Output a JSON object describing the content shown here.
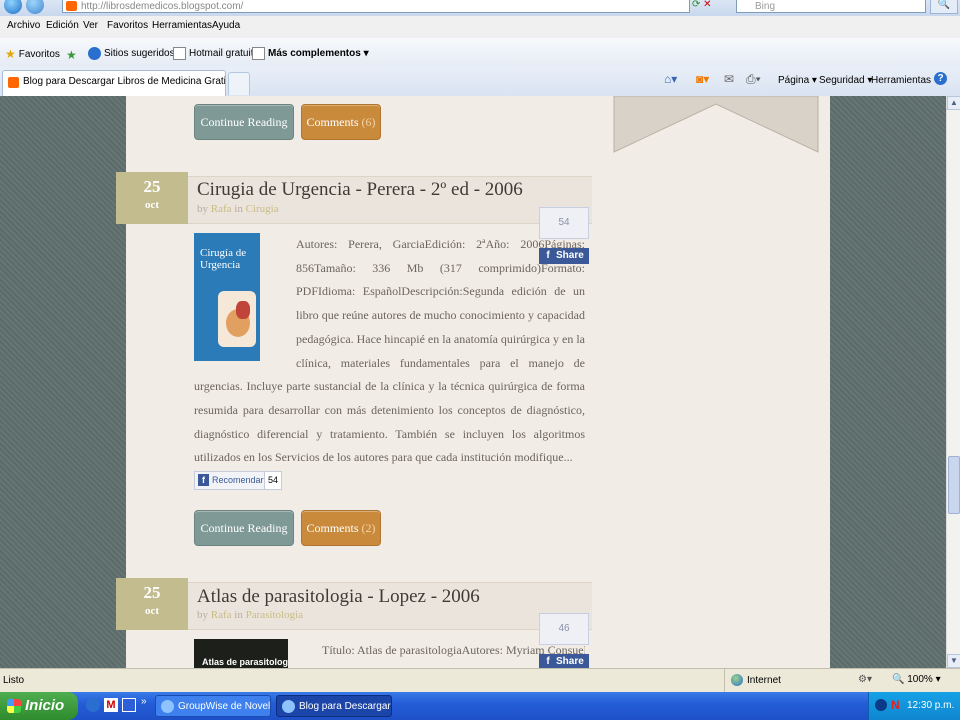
{
  "browser": {
    "address_url": "http://librosdemedicos.blogspot.com/",
    "search_placeholder": "Bing",
    "menu": [
      "Archivo",
      "Edición",
      "Ver",
      "Favoritos",
      "Herramientas",
      "Ayuda"
    ],
    "favorites": {
      "label": "Favoritos",
      "items": [
        "Sitios sugeridos ▾",
        "Hotmail gratuito",
        "Más complementos ▾"
      ]
    },
    "tab_title": "Blog para Descargar Libros de Medicina Gratis en Pdf",
    "command_bar": [
      "Página ▾",
      "Seguridad ▾",
      "Herramientas ▾"
    ]
  },
  "page": {
    "prev_post_buttons": {
      "continue": "Continue Reading",
      "comments": "Comments",
      "comments_count": "(6)"
    },
    "posts": [
      {
        "day": "25",
        "month": "oct",
        "title": "Cirugia de Urgencia - Perera - 2º ed - 2006",
        "by": "by",
        "author": "Rafa",
        "in": "in",
        "category": "Cirugia",
        "share_count": "54",
        "share_label": "Share",
        "book_cover_title": "Cirugía de Urgencia",
        "text": "Autores: Perera, GarciaEdición: 2ªAño: 2006Páginas: 856Tamaño: 336 Mb (317 comprimido)Formato: PDFIdioma: EspañolDescripción:Segunda edición de un libro que reúne autores de mucho conocimiento y capacidad pedagógica. Hace hincapié en la anatomía quirúrgica y en la clínica, materiales fundamentales para el manejo de urgencias. Incluye parte sustancial de la clínica y la técnica quirúrgica de forma resumida para desarrollar con más detenimiento los conceptos de diagnóstico, diagnóstico diferencial y tratamiento. También se incluyen los algoritmos utilizados en los Servicios de los autores para que cada institución modifique...",
        "recommend_label": "Recomendar",
        "recommend_count": "54",
        "continue": "Continue Reading",
        "comments": "Comments",
        "comments_count": "(2)"
      },
      {
        "day": "25",
        "month": "oct",
        "title": "Atlas de parasitologia - Lopez - 2006",
        "by": "by",
        "author": "Rafa",
        "in": "in",
        "category": "Parasitologia",
        "share_count": "46",
        "share_label": "Share",
        "book_cover_title": "Atlas de parasitología",
        "text": "Título: Atlas de parasitologiaAutores: Myriam Consuelo"
      }
    ]
  },
  "status": {
    "left": "Listo",
    "zone": "Internet",
    "zoom": "100%"
  },
  "taskbar": {
    "start": "Inicio",
    "tasks": [
      "GroupWise de Novell ...",
      "Blog para Descargar ..."
    ],
    "clock": "12:30 p.m."
  },
  "colors": {
    "continue_button": "#7f9a96",
    "comments_button": "#c98a3c",
    "date_badge": "#c3bc8e",
    "facebook": "#3b5998",
    "page_background": "#5f6f6e"
  }
}
